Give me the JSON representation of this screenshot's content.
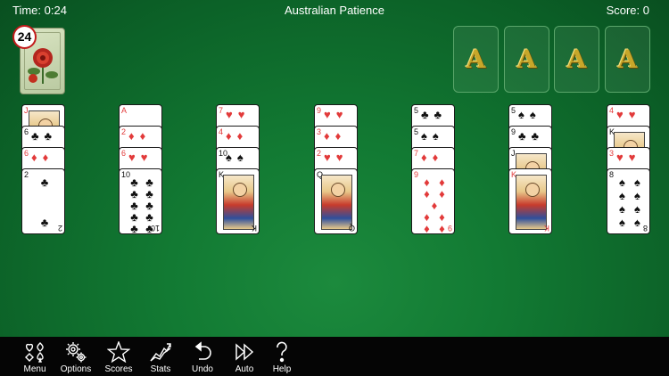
{
  "header": {
    "time": "Time: 0:24",
    "title": "Australian Patience",
    "score": "Score: 0"
  },
  "stock": {
    "count": "24"
  },
  "foundations": [
    "A",
    "A",
    "A",
    "A"
  ],
  "tableau": [
    [
      {
        "rank": "J",
        "suit": "♥",
        "color": "red",
        "face": true
      },
      {
        "rank": "6",
        "suit": "♣",
        "color": "blk"
      },
      {
        "rank": "6",
        "suit": "♦",
        "color": "red"
      },
      {
        "rank": "2",
        "suit": "♣",
        "color": "blk",
        "full": true
      }
    ],
    [
      {
        "rank": "A",
        "suit": "♥",
        "color": "red"
      },
      {
        "rank": "2",
        "suit": "♦",
        "color": "red"
      },
      {
        "rank": "6",
        "suit": "♥",
        "color": "red"
      },
      {
        "rank": "10",
        "suit": "♣",
        "color": "blk",
        "full": true
      }
    ],
    [
      {
        "rank": "7",
        "suit": "♥",
        "color": "red"
      },
      {
        "rank": "4",
        "suit": "♦",
        "color": "red"
      },
      {
        "rank": "10",
        "suit": "♠",
        "color": "blk"
      },
      {
        "rank": "K",
        "suit": "♣",
        "color": "blk",
        "face": true,
        "full": true
      }
    ],
    [
      {
        "rank": "9",
        "suit": "♥",
        "color": "red"
      },
      {
        "rank": "3",
        "suit": "♦",
        "color": "red"
      },
      {
        "rank": "2",
        "suit": "♥",
        "color": "red"
      },
      {
        "rank": "Q",
        "suit": "♠",
        "color": "blk",
        "face": true,
        "full": true
      }
    ],
    [
      {
        "rank": "5",
        "suit": "♣",
        "color": "blk"
      },
      {
        "rank": "5",
        "suit": "♠",
        "color": "blk"
      },
      {
        "rank": "7",
        "suit": "♦",
        "color": "red"
      },
      {
        "rank": "9",
        "suit": "♦",
        "color": "red",
        "full": true
      }
    ],
    [
      {
        "rank": "5",
        "suit": "♠",
        "color": "blk"
      },
      {
        "rank": "9",
        "suit": "♣",
        "color": "blk"
      },
      {
        "rank": "J",
        "suit": "♣",
        "color": "blk",
        "face": true
      },
      {
        "rank": "K",
        "suit": "♦",
        "color": "red",
        "face": true,
        "full": true
      }
    ],
    [
      {
        "rank": "4",
        "suit": "♥",
        "color": "red"
      },
      {
        "rank": "K",
        "suit": "♠",
        "color": "blk",
        "face": true
      },
      {
        "rank": "3",
        "suit": "♥",
        "color": "red"
      },
      {
        "rank": "8",
        "suit": "♠",
        "color": "blk",
        "full": true
      }
    ]
  ],
  "toolbar": {
    "menu": "Menu",
    "options": "Options",
    "scores": "Scores",
    "stats": "Stats",
    "undo": "Undo",
    "auto": "Auto",
    "help": "Help"
  }
}
